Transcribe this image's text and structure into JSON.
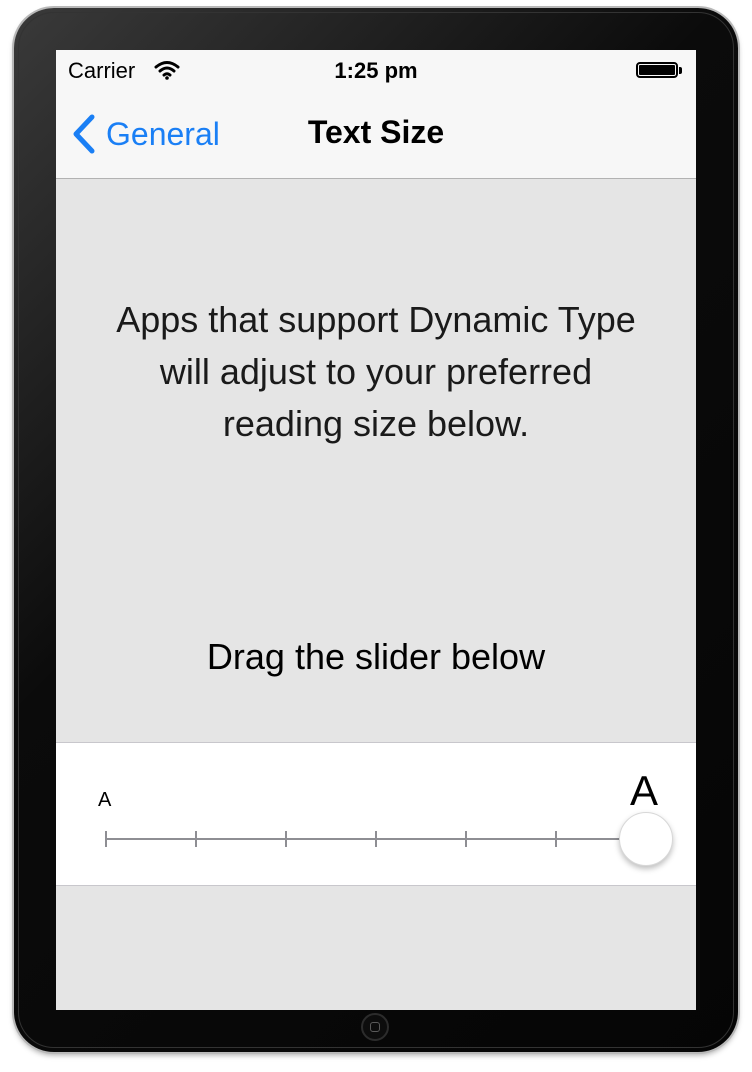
{
  "status_bar": {
    "carrier": "Carrier",
    "time": "1:25 pm",
    "wifi_icon": "wifi-icon",
    "battery_icon": "battery-icon"
  },
  "nav": {
    "back_label": "General",
    "back_icon": "chevron-left-icon",
    "title": "Text Size"
  },
  "content": {
    "description": "Apps that support Dynamic Type will adjust to your preferred reading size below.",
    "drag_hint": "Drag the slider below"
  },
  "slider": {
    "small_label": "A",
    "large_label": "A",
    "steps": 7,
    "selected_step": 7
  },
  "colors": {
    "accent": "#1a7ff5",
    "background": "#e5e5e5",
    "navbar": "#f7f7f7",
    "cell": "#ffffff"
  }
}
